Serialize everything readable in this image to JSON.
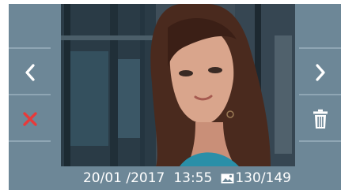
{
  "status": {
    "date": "20/01 /2017",
    "time": "13:55",
    "image_index": "130",
    "image_total": "/149"
  },
  "icons": {
    "prev": "chevron-left-icon",
    "next": "chevron-right-icon",
    "delete": "x-icon",
    "trash": "trash-icon",
    "picture": "image-icon"
  },
  "colors": {
    "panel": "#6d8797",
    "delete_accent": "#e83a3a"
  }
}
